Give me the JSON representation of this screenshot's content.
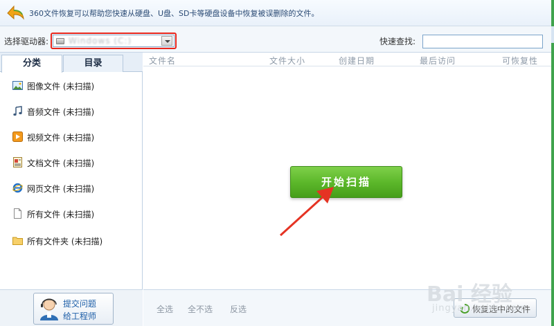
{
  "banner": {
    "description": "360文件恢复可以帮助您快速从硬盘、U盘、SD卡等硬盘设备中恢复被误删除的文件。"
  },
  "toolbar": {
    "drive_label": "选择驱动器:",
    "drive_value": "Windows (C:)",
    "quick_search_label": "快速查找:",
    "quick_search_value": ""
  },
  "tabs": [
    {
      "label": "分类",
      "active": true
    },
    {
      "label": "目录",
      "active": false
    }
  ],
  "categories": [
    {
      "label": "图像文件 (未扫描)",
      "icon": "image-icon"
    },
    {
      "label": "音频文件 (未扫描)",
      "icon": "music-note-icon"
    },
    {
      "label": "视频文件 (未扫描)",
      "icon": "video-icon"
    },
    {
      "label": "文档文件 (未扫描)",
      "icon": "document-icon"
    },
    {
      "label": "网页文件 (未扫描)",
      "icon": "ie-icon"
    },
    {
      "label": "所有文件 (未扫描)",
      "icon": "file-icon"
    },
    {
      "label": "所有文件夹 (未扫描)",
      "icon": "folder-icon"
    }
  ],
  "engineer": {
    "line1": "提交问题",
    "line2": "给工程师"
  },
  "columns": [
    "文件名",
    "文件大小",
    "创建日期",
    "最后访问",
    "可恢复性"
  ],
  "scan_button": "开始扫描",
  "footer": {
    "select_all": "全选",
    "select_none": "全不选",
    "invert": "反选",
    "restore": "恢复选中的文件"
  },
  "watermark": {
    "brand": "Bai 经验",
    "url": "jingyan.baidu.com"
  },
  "colors": {
    "accent_green": "#5db82b",
    "highlight_red": "#e8261c",
    "arrow_red": "#e53323"
  }
}
